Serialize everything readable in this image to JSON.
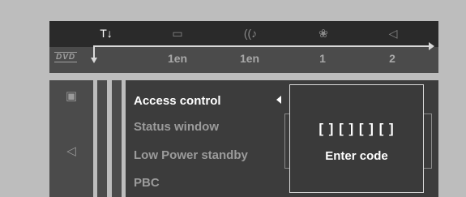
{
  "top_bar": {
    "logo": "DVD",
    "tabs": [
      {
        "id": "setup",
        "icon": "setup-tools-icon",
        "glyph": "T↓",
        "value": ""
      },
      {
        "id": "subtitle",
        "icon": "subtitle-icon",
        "glyph": "▭",
        "value": "1en"
      },
      {
        "id": "audio",
        "icon": "audio-icon",
        "glyph": "((♪",
        "value": "1en"
      },
      {
        "id": "angle",
        "icon": "angle-icon",
        "glyph": "❀",
        "value": "1"
      },
      {
        "id": "speaker",
        "icon": "speaker-icon",
        "glyph": "◁",
        "value": "2"
      }
    ]
  },
  "side_icons": [
    {
      "id": "picture",
      "icon": "picture-icon",
      "glyph": "▣"
    },
    {
      "id": "sound",
      "icon": "sound-icon",
      "glyph": "◁"
    }
  ],
  "menu": {
    "items": [
      {
        "label": "Access control",
        "selected": true
      },
      {
        "label": "Status window",
        "selected": false
      },
      {
        "label": "Low Power standby",
        "selected": false
      },
      {
        "label": "PBC",
        "selected": false
      }
    ]
  },
  "popup": {
    "code": "[ ] [ ] [ ] [ ]",
    "label": "Enter code"
  }
}
